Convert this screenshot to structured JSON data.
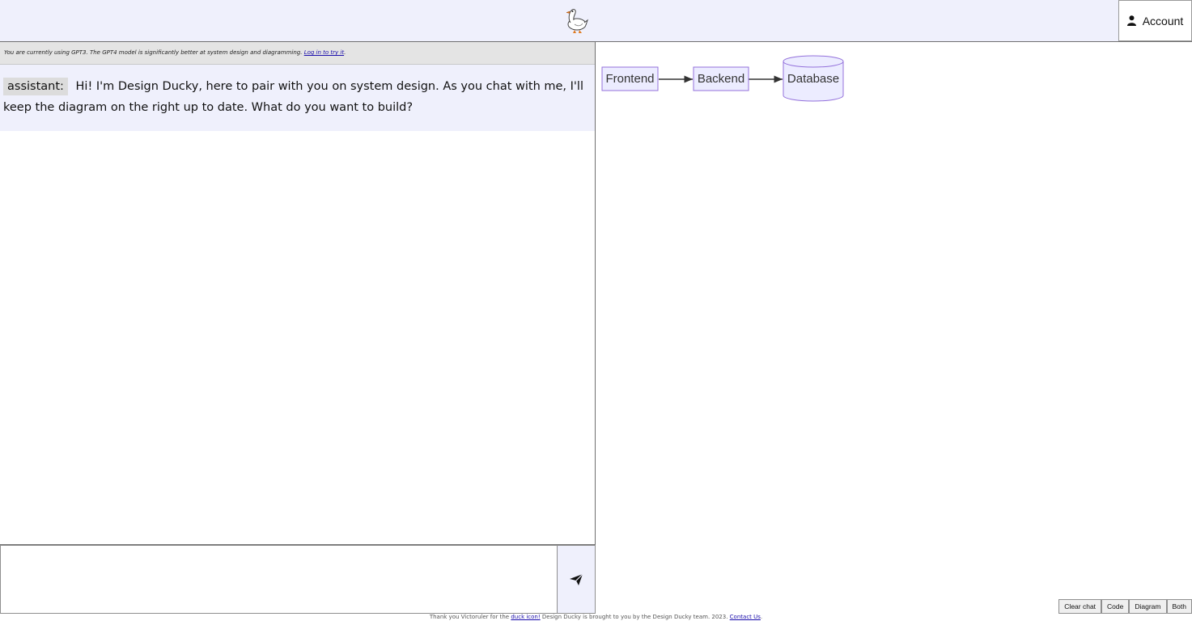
{
  "header": {
    "logo_icon": "duck-icon",
    "account_label": "Account",
    "account_icon": "user-icon"
  },
  "notice": {
    "text": "You are currently using GPT3. The GPT4 model is significantly better at system design and diagramming. ",
    "link_text": "Log in to try it",
    "suffix": "."
  },
  "chat": {
    "messages": [
      {
        "role": "assistant:",
        "text": "Hi! I'm Design Ducky, here to pair with you on system design. As you chat with me, I'll keep the diagram on the right up to date. What do you want to build?"
      }
    ],
    "input_value": "",
    "send_icon": "send-icon"
  },
  "diagram": {
    "nodes": [
      {
        "label": "Frontend",
        "shape": "rect"
      },
      {
        "label": "Backend",
        "shape": "rect"
      },
      {
        "label": "Database",
        "shape": "cylinder"
      }
    ],
    "edges": [
      [
        "Frontend",
        "Backend"
      ],
      [
        "Backend",
        "Database"
      ]
    ],
    "node_fill": "#ececff",
    "node_stroke": "#9370db"
  },
  "view_buttons": {
    "clear": "Clear chat",
    "code": "Code",
    "diagram": "Diagram",
    "both": "Both"
  },
  "footer": {
    "part1": "Thank you Victoruler for the ",
    "link1": "duck icon!",
    "part2": " Design Ducky is brought to you by the Design Ducky team. 2023. ",
    "link2": "Contact Us",
    "part3": "."
  }
}
